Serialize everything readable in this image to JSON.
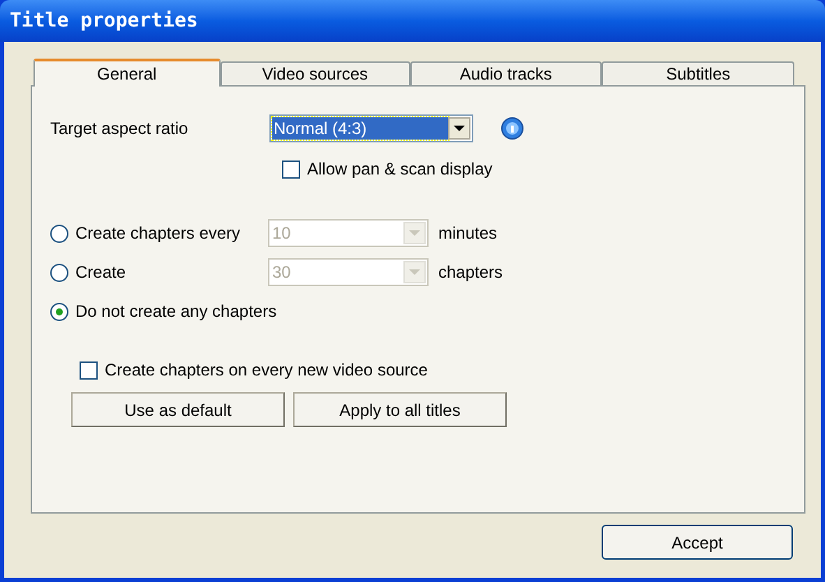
{
  "window": {
    "title": "Title properties"
  },
  "tabs": [
    {
      "label": "General",
      "selected": true
    },
    {
      "label": "Video sources",
      "selected": false
    },
    {
      "label": "Audio tracks",
      "selected": false
    },
    {
      "label": "Subtitles",
      "selected": false
    }
  ],
  "aspect": {
    "label": "Target aspect ratio",
    "value": "Normal (4:3)"
  },
  "pan_scan": {
    "label": "Allow pan & scan display",
    "checked": false
  },
  "chapter_options": [
    {
      "label": "Create chapters every",
      "selected": false,
      "value": "10",
      "unit": "minutes",
      "disabled": true
    },
    {
      "label": "Create",
      "selected": false,
      "value": "30",
      "unit": "chapters",
      "disabled": true
    },
    {
      "label": "Do not create any chapters",
      "selected": true
    }
  ],
  "new_source": {
    "label": "Create chapters on every new video source",
    "checked": false
  },
  "buttons": [
    "Use as default",
    "Apply to all titles"
  ],
  "accept": "Accept"
}
